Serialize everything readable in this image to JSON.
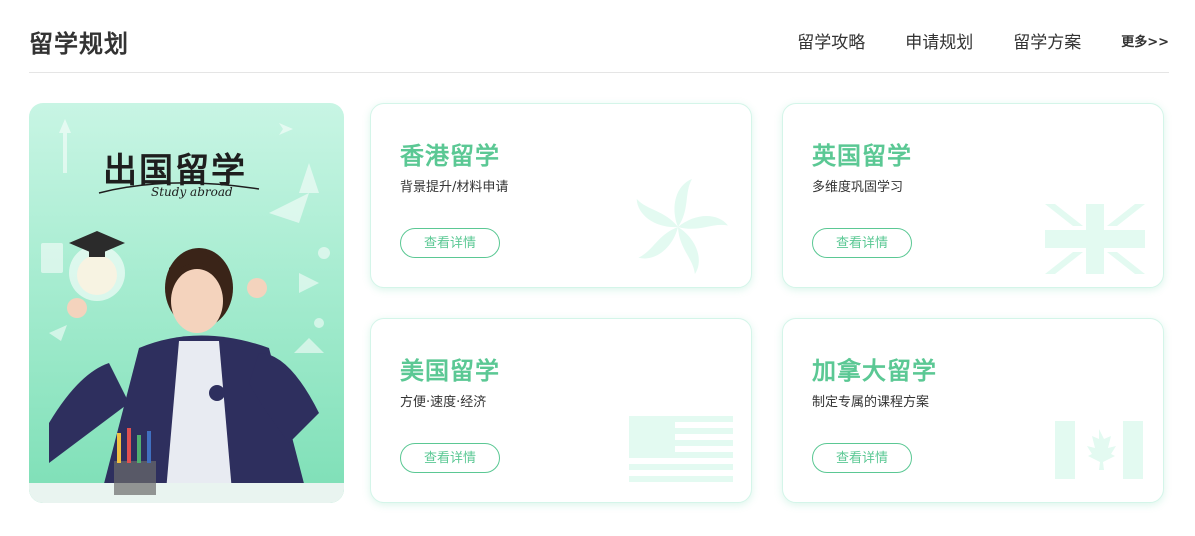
{
  "header": {
    "title": "留学规划",
    "nav": [
      "留学攻略",
      "申请规划",
      "留学方案"
    ],
    "more": "更多>>"
  },
  "banner": {
    "title": "出国留学",
    "subtitle": "Study abroad"
  },
  "cards": [
    {
      "title": "香港留学",
      "desc": "背景提升/材料申请",
      "button": "查看详情",
      "icon": "bauhinia-icon"
    },
    {
      "title": "英国留学",
      "desc": "多维度巩固学习",
      "button": "查看详情",
      "icon": "union-jack-icon"
    },
    {
      "title": "美国留学",
      "desc": "方便·速度·经济",
      "button": "查看详情",
      "icon": "us-flag-icon"
    },
    {
      "title": "加拿大留学",
      "desc": "制定专属的课程方案",
      "button": "查看详情",
      "icon": "maple-leaf-icon"
    }
  ],
  "colors": {
    "accent": "#5bc894",
    "deco": "#e3faf1",
    "text": "#333333"
  }
}
